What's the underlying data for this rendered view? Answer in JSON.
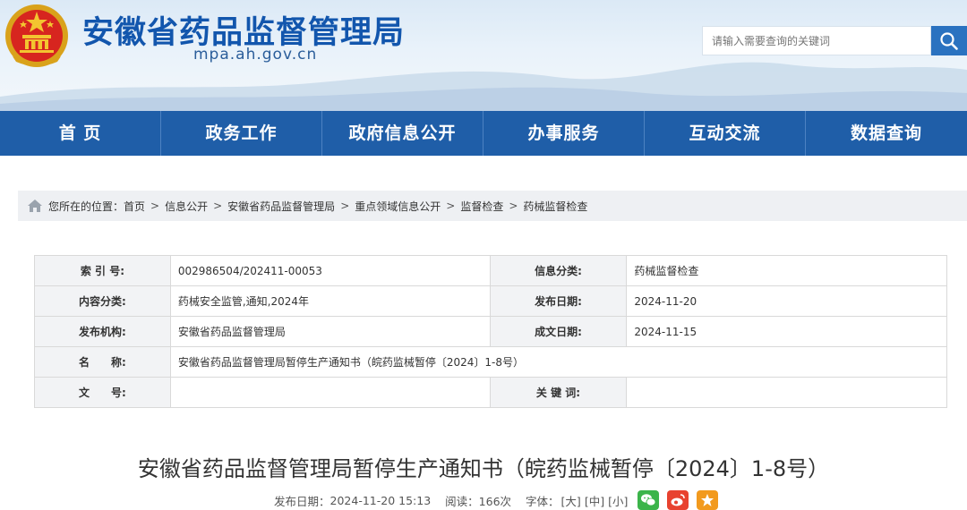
{
  "header": {
    "site_title": "安徽省药品监督管理局",
    "site_domain": "mpa.ah.gov.cn",
    "search_placeholder": "请输入需要查询的关键词"
  },
  "nav": [
    "首 页",
    "政务工作",
    "政府信息公开",
    "办事服务",
    "互动交流",
    "数据查询"
  ],
  "breadcrumb": {
    "prefix": "您所在的位置：",
    "items": [
      "首页",
      "信息公开",
      "安徽省药品监督管理局",
      "重点领域信息公开",
      "监督检查",
      "药械监督检查"
    ],
    "separator": ">"
  },
  "info": {
    "index_label": "索 引 号:",
    "index_value": "002986504/202411-00053",
    "info_cat_label": "信息分类:",
    "info_cat_value": "药械监督检查",
    "content_cat_label": "内容分类:",
    "content_cat_value": "药械安全监管,通知,2024年",
    "pub_date_label": "发布日期:",
    "pub_date_value": "2024-11-20",
    "publisher_label": "发布机构:",
    "publisher_value": "安徽省药品监督管理局",
    "made_date_label": "成文日期:",
    "made_date_value": "2024-11-15",
    "name_label": "名　　称:",
    "name_value": "安徽省药品监督管理局暂停生产通知书（皖药监械暂停〔2024〕1-8号）",
    "doc_no_label": "文　　号:",
    "doc_no_value": "",
    "keywords_label": "关 键 词:",
    "keywords_value": ""
  },
  "article": {
    "title": "安徽省药品监督管理局暂停生产通知书（皖药监械暂停〔2024〕1-8号）",
    "pub_time_label": "发布日期：",
    "pub_time": "2024-11-20 15:13",
    "views_label": "阅读：",
    "views": "166次",
    "font_label": "字体：",
    "font_large": "[大]",
    "font_medium": "[中]",
    "font_small": "[小]"
  },
  "colors": {
    "nav_bg": "#1f5ea8",
    "title_blue": "#1256ad",
    "wechat": "#3bb44a",
    "weibo": "#e8422f",
    "favorite": "#f29a1e"
  }
}
